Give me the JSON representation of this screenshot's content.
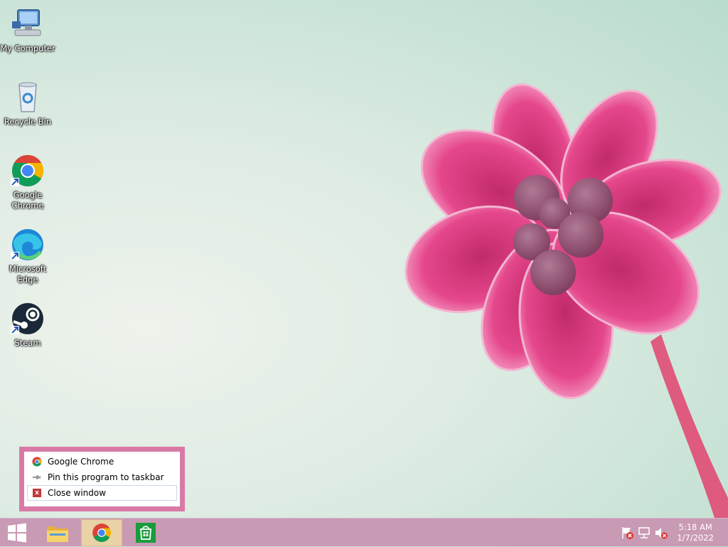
{
  "desktop": {
    "icons": [
      {
        "label": "My Computer",
        "icon": "computer-icon"
      },
      {
        "label": "Recycle Bin",
        "icon": "recycle-bin-icon"
      },
      {
        "label": "Google\nChrome",
        "icon": "chrome-icon"
      },
      {
        "label": "Microsoft\nEdge",
        "icon": "edge-icon"
      },
      {
        "label": "Steam",
        "icon": "steam-icon"
      }
    ]
  },
  "jumplist": {
    "app_title": "Google Chrome",
    "pin_label": "Pin this program to taskbar",
    "close_label": "Close window",
    "close_glyph": "x"
  },
  "taskbar": {
    "start_icon": "windows-start-icon",
    "apps": [
      "file-explorer-icon",
      "chrome-icon",
      "store-icon"
    ],
    "active_app": "chrome-icon",
    "tray_icons": [
      "action-center-flag-icon",
      "network-icon",
      "volume-muted-icon"
    ],
    "clock": {
      "time": "5:18 AM",
      "date": "1/7/2022"
    }
  },
  "colors": {
    "taskbar": "#c99ab4",
    "jumplist_border": "#d97aa6",
    "close_icon": "#c23a3a",
    "active_taskbar_button": "#e8d2a6"
  }
}
